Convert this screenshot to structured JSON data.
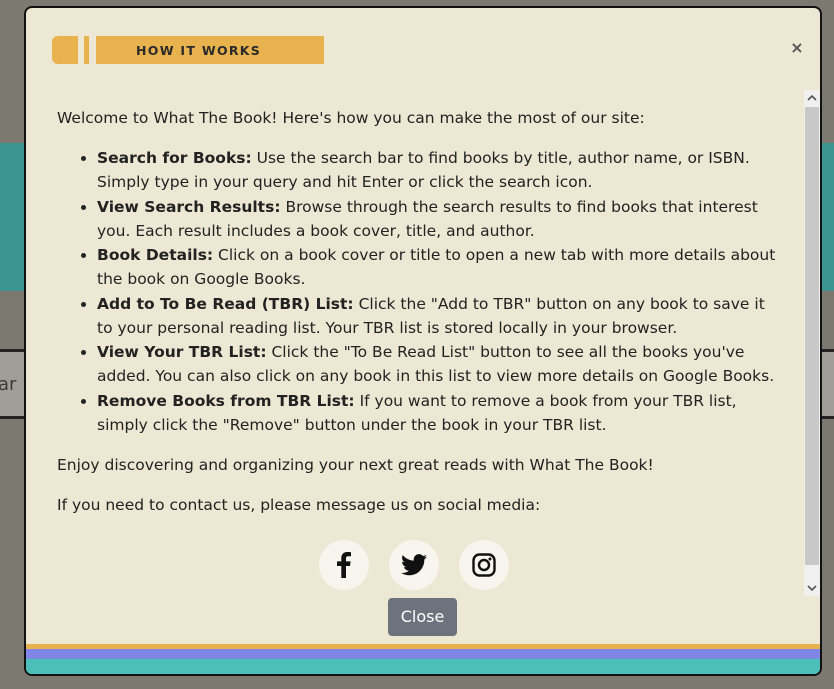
{
  "background": {
    "search_partial_text": "ar"
  },
  "modal": {
    "title": "HOW IT WORKS",
    "close_symbol": "×",
    "intro": "Welcome to What The Book! Here's how you can make the most of our site:",
    "features": [
      {
        "title": "Search for Books:",
        "text": " Use the search bar to find books by title, author name, or ISBN. Simply type in your query and hit Enter or click the search icon."
      },
      {
        "title": "View Search Results:",
        "text": " Browse through the search results to find books that interest you. Each result includes a book cover, title, and author."
      },
      {
        "title": "Book Details:",
        "text": " Click on a book cover or title to open a new tab with more details about the book on Google Books."
      },
      {
        "title": "Add to To Be Read (TBR) List:",
        "text": " Click the \"Add to TBR\" button on any book to save it to your personal reading list. Your TBR list is stored locally in your browser."
      },
      {
        "title": "View Your TBR List:",
        "text": " Click the \"To Be Read List\" button to see all the books you've added. You can also click on any book in this list to view more details on Google Books."
      },
      {
        "title": "Remove Books from TBR List:",
        "text": " If you want to remove a book from your TBR list, simply click the \"Remove\" button under the book in your TBR list."
      }
    ],
    "outro": "Enjoy discovering and organizing your next great reads with What The Book!",
    "contact": "If you need to contact us, please message us on social media:",
    "social_icons": [
      "facebook-icon",
      "twitter-icon",
      "instagram-icon"
    ],
    "close_button_label": "Close"
  },
  "colors": {
    "modal_bg": "#ede8d4",
    "banner": "#e8b24e",
    "stripe_yellow": "#e8b24e",
    "stripe_purple": "#7f86e6",
    "stripe_teal": "#4bbfb8",
    "close_button": "#6c737d"
  }
}
